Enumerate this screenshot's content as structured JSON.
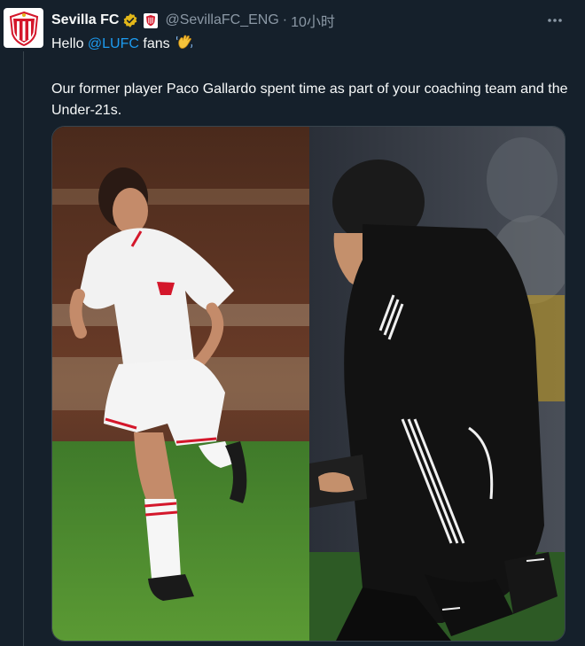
{
  "tweet": {
    "author_name": "Sevilla FC",
    "author_handle": "@SevillaFC_ENG",
    "separator": "·",
    "timestamp": "10小时",
    "greeting_prefix": "Hello ",
    "mention": "@LUFC",
    "greeting_suffix": " fans",
    "body": "Our former player Paco Gallardo spent time as part of your coaching team and the Under-21s."
  },
  "icons": {
    "avatar": "sevilla-crest-icon",
    "verified": "gold-verified-badge-icon",
    "affiliate": "sevilla-crest-icon",
    "wave": "waving-hand-icon",
    "more": "more-options-icon"
  },
  "colors": {
    "background": "#15202b",
    "text": "#f7f9f9",
    "muted": "#8b98a5",
    "link": "#1d9bf0",
    "verified_gold": "#e2b719",
    "sevilla_red": "#d4172b",
    "pitch_green": "#4c8a2e"
  }
}
